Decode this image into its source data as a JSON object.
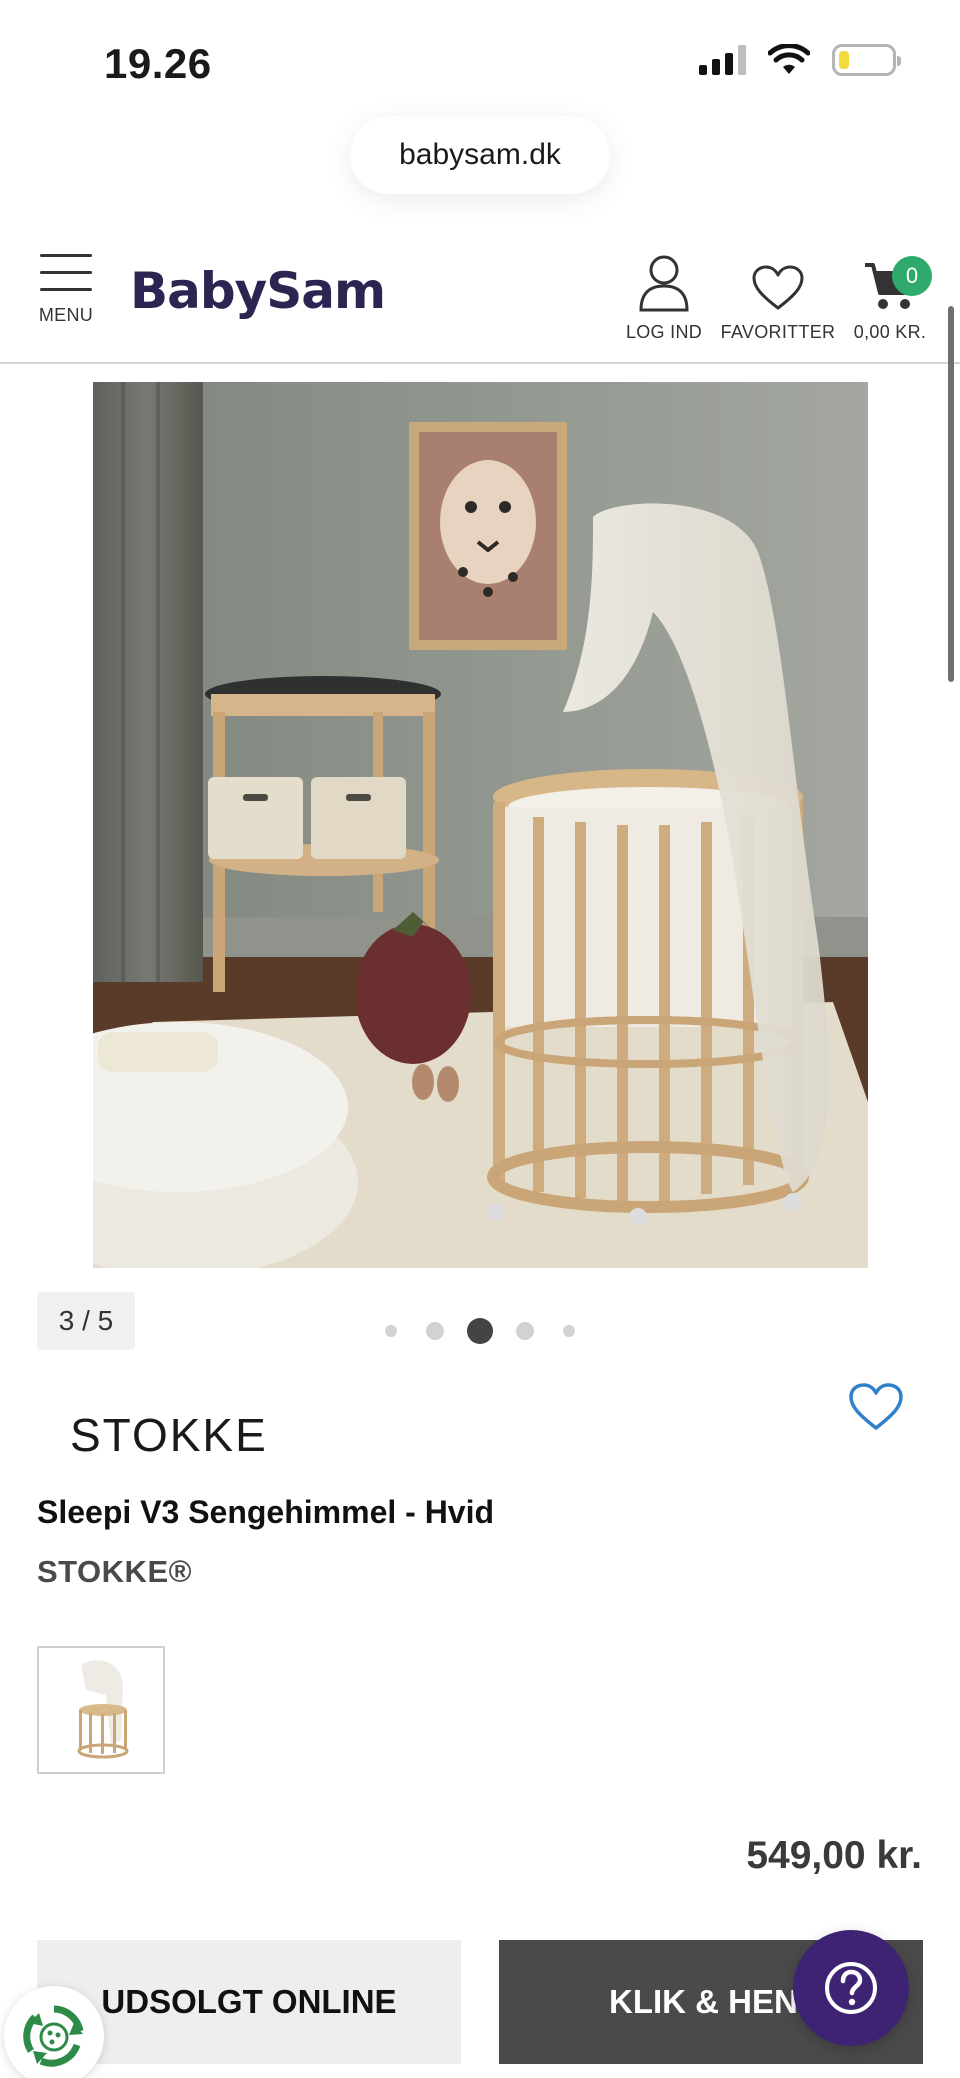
{
  "status_bar": {
    "time": "19.26"
  },
  "browser": {
    "url": "babysam.dk"
  },
  "header": {
    "logo": "BabySam",
    "menu_label": "MENU",
    "login_label": "LOG IND",
    "favorites_label": "FAVORITTER",
    "cart_total": "0,00 KR.",
    "cart_count": "0"
  },
  "gallery": {
    "counter": "3 / 5",
    "current_index": 3,
    "total": 5
  },
  "product": {
    "brand_logo": "STOKKE",
    "title": "Sleepi V3 Sengehimmel - Hvid",
    "brand": "STOKKE®",
    "price": "549,00 kr."
  },
  "actions": {
    "sold_out_label": "UDSOLGT ONLINE",
    "click_collect_label": "KLIK & HENT"
  },
  "colors": {
    "brand_purple": "#2e2452",
    "help_purple": "#3f2373",
    "badge_green": "#2faa6a",
    "dark_button": "#4a4a4a",
    "recycle_green": "#2e8b47"
  },
  "icons": [
    "menu-icon",
    "user-icon",
    "heart-icon",
    "cart-icon",
    "help-icon",
    "recycle-icon",
    "signal-icon",
    "wifi-icon",
    "battery-icon"
  ]
}
